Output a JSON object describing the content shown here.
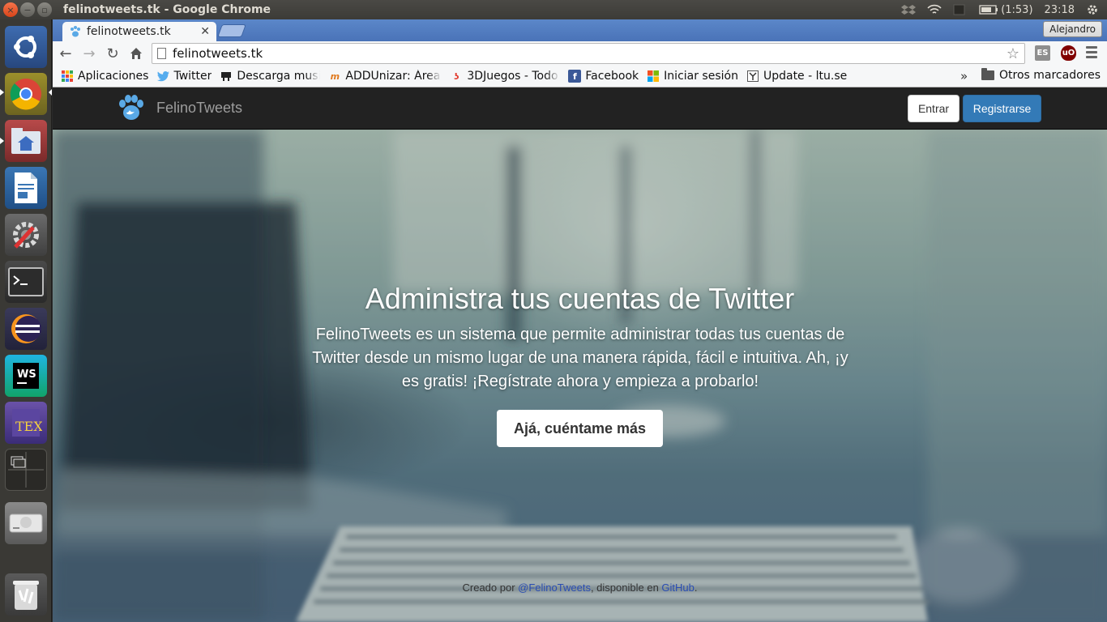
{
  "window": {
    "title": "felinotweets.tk - Google Chrome"
  },
  "panel": {
    "battery": "(1:53)",
    "clock": "23:18"
  },
  "launcher": {
    "items": [
      "ubuntu-dash",
      "google-chrome",
      "files",
      "libreoffice-writer",
      "system-settings",
      "terminal",
      "eclipse",
      "webstorm",
      "texmaker",
      "workspace-switcher",
      "drive",
      "trash"
    ]
  },
  "browser": {
    "tab": {
      "title": "felinotweets.tk"
    },
    "profile": "Alejandro",
    "url": "felinotweets.tk",
    "bookmarks": [
      "Aplicaciones",
      "Twitter",
      "Descarga musica",
      "ADDUnizar: Área",
      "3DJuegos - Todo",
      "Facebook",
      "Iniciar sesión",
      "Update - ltu.se"
    ],
    "chevron": "»",
    "other_bookmarks": "Otros marcadores",
    "ext_es": "ES"
  },
  "site": {
    "brand": "FelinoTweets",
    "login": "Entrar",
    "signup": "Registrarse",
    "headline": "Administra tus cuentas de Twitter",
    "lead": "FelinoTweets es un sistema que permite administrar todas tus cuentas de Twitter desde un mismo lugar de una manera rápida, fácil e intuitiva. Ah, ¡y es gratis! ¡Regístrate ahora y empieza a probarlo!",
    "cta": "Ajá, cuéntame más",
    "footer": {
      "prefix": "Creado por ",
      "author_link": "@FelinoTweets",
      "middle": ", disponible en ",
      "repo_link": "GitHub",
      "suffix": "."
    }
  },
  "colors": {
    "primary": "#337ab7",
    "navbar": "#222222",
    "tabstrip": "#4a73b8"
  }
}
